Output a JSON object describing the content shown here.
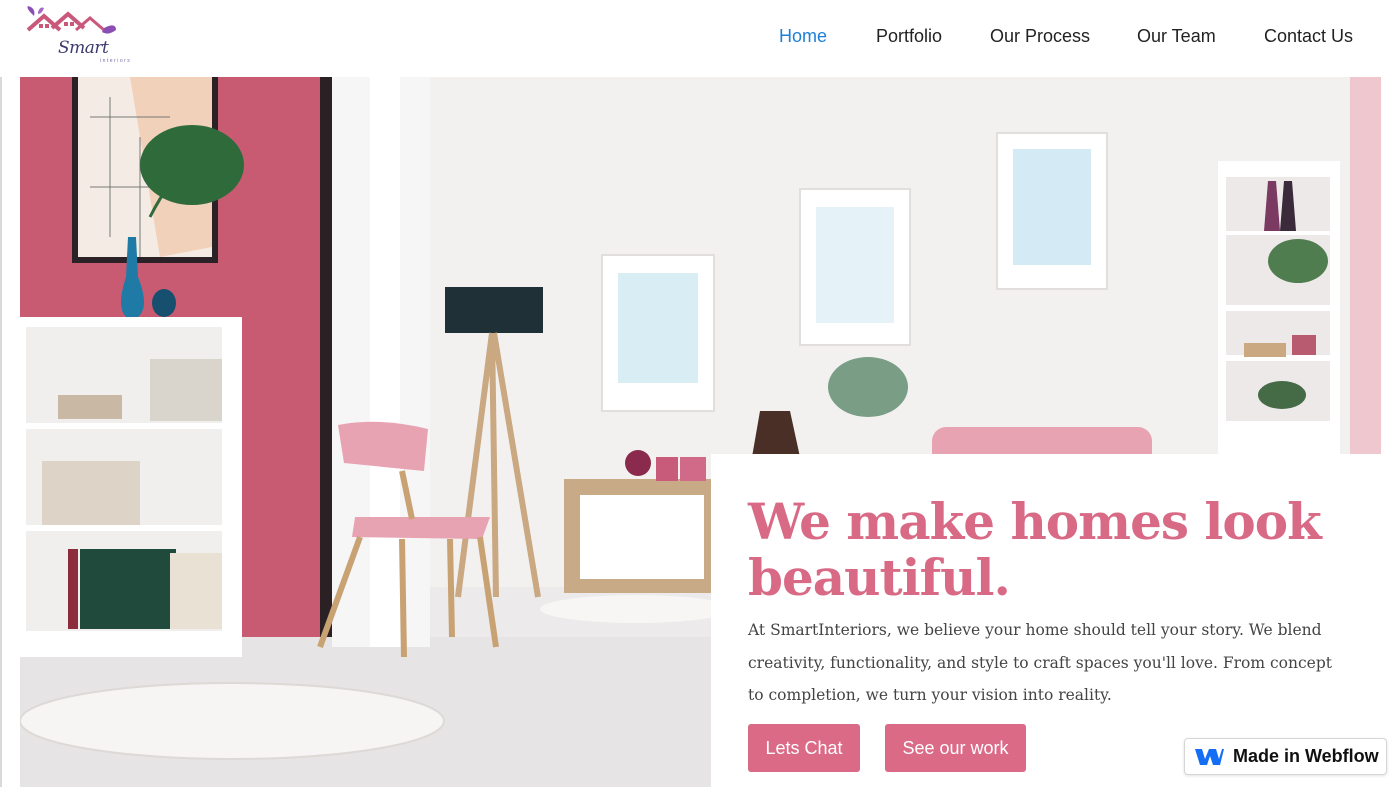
{
  "brand": {
    "logo_text": "Smart",
    "logo_subtext": "interiors"
  },
  "nav": {
    "items": [
      {
        "label": "Home",
        "active": true
      },
      {
        "label": "Portfolio",
        "active": false
      },
      {
        "label": "Our Process",
        "active": false
      },
      {
        "label": "Our Team",
        "active": false
      },
      {
        "label": "Contact Us",
        "active": false
      }
    ]
  },
  "hero": {
    "headline": "We make homes look beautiful.",
    "description": "At SmartInteriors, we believe your home should tell your story. We blend creativity, functionality, and style to craft spaces you'll love. From concept to completion, we turn your vision into reality.",
    "buttons": {
      "chat_label": "Lets Chat",
      "work_label": "See our work"
    }
  },
  "badge": {
    "label": "Made in Webflow"
  },
  "colors": {
    "accent": "#db6a86",
    "nav_active": "#1e7fd8",
    "wall_pink": "#c85a72"
  }
}
